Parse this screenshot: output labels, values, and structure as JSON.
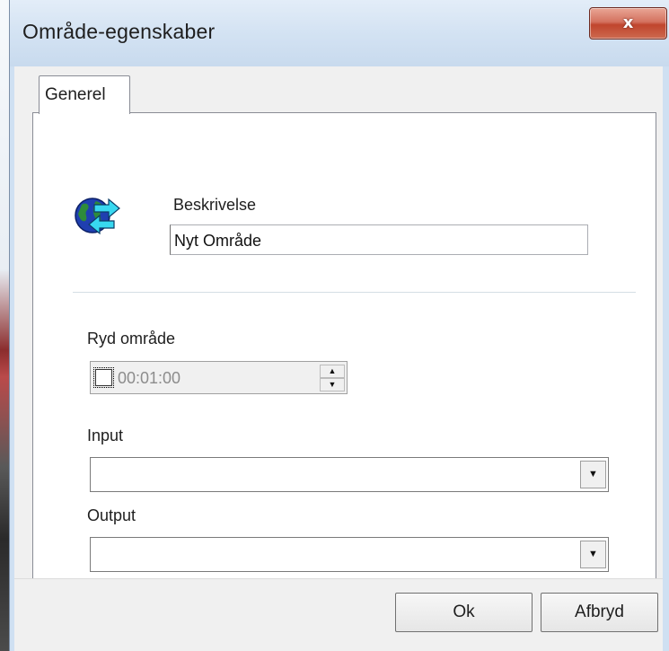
{
  "window": {
    "title": "Område-egenskaber",
    "close_glyph": "x"
  },
  "tabs": [
    {
      "label": "Generel",
      "active": true
    }
  ],
  "general": {
    "icon": "globe-arrows-icon",
    "description_label": "Beskrivelse",
    "description_value": "Nyt Område",
    "clear_area_label": "Ryd område",
    "clear_area_checked": false,
    "clear_area_time": "00:01:00",
    "input_label": "Input",
    "input_value": "",
    "output_label": "Output",
    "output_value": ""
  },
  "buttons": {
    "ok": "Ok",
    "cancel": "Afbryd"
  },
  "colors": {
    "titlebar": "#cfe0f2",
    "close_button": "#c8533b",
    "dialog_bg": "#f0f0f0"
  }
}
